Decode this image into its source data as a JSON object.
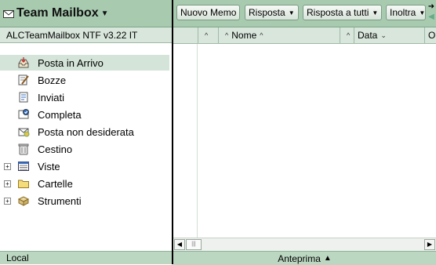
{
  "left": {
    "title": "Team Mailbox",
    "database": "ALCTeamMailbox NTF v3.22 IT",
    "status": "Local",
    "nav": [
      {
        "label": "Posta in Arrivo",
        "icon": "inbox-icon",
        "selected": true
      },
      {
        "label": "Bozze",
        "icon": "drafts-icon"
      },
      {
        "label": "Inviati",
        "icon": "sent-icon"
      },
      {
        "label": "Completa",
        "icon": "complete-icon"
      },
      {
        "label": "Posta non desiderata",
        "icon": "junk-mail-icon"
      },
      {
        "label": "Cestino",
        "icon": "trash-icon"
      },
      {
        "label": "Viste",
        "icon": "views-icon",
        "expandable": true
      },
      {
        "label": "Cartelle",
        "icon": "folder-icon",
        "expandable": true
      },
      {
        "label": "Strumenti",
        "icon": "tools-icon",
        "expandable": true
      }
    ]
  },
  "toolbar": {
    "new_memo": "Nuovo Memo",
    "reply": "Risposta",
    "reply_all": "Risposta a tutti",
    "forward": "Inoltra"
  },
  "columns": {
    "name": "Nome",
    "date": "Data",
    "cut": "Or"
  },
  "preview": {
    "label": "Anteprima"
  },
  "colors": {
    "header_green": "#a8cbb0",
    "subheader_green": "#d9e6dc",
    "status_green": "#bcd7c1",
    "selection": "#d4e4d8"
  }
}
